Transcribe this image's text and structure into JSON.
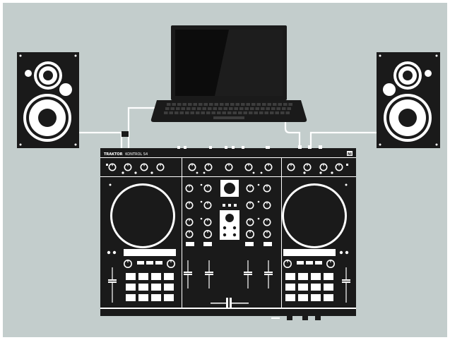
{
  "scene": {
    "background_color": "#c3cdcc",
    "device_color": "#1a1a1a",
    "cable_color": "#ffffff"
  },
  "controller": {
    "brand_label": "TRAKTOR",
    "model_label": "KONTROL S4",
    "logo_label": "NI"
  },
  "icons": {
    "laptop": "laptop-icon",
    "left_speaker": "speaker-icon",
    "right_speaker": "speaker-icon",
    "controller": "dj-controller-icon"
  }
}
